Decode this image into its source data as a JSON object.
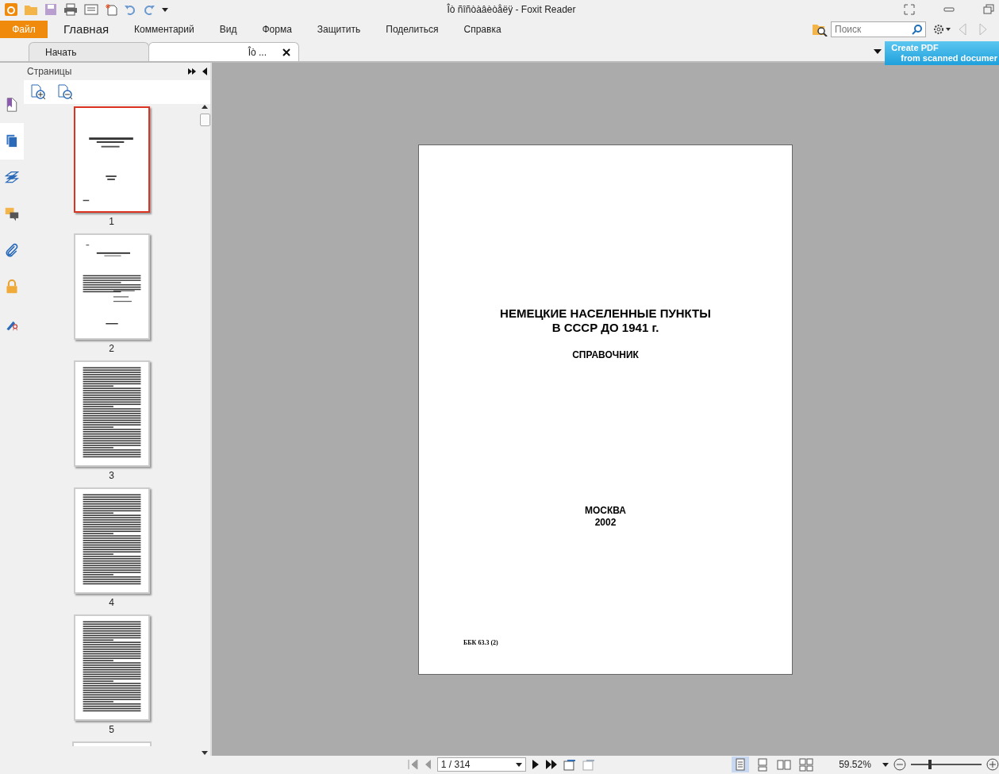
{
  "window": {
    "title": "Îò ñîñòàâèòåëÿ - Foxit Reader"
  },
  "file_button": "Файл",
  "ribbon_tabs": [
    {
      "label": "Главная",
      "selected": true
    },
    {
      "label": "Комментарий",
      "selected": false
    },
    {
      "label": "Вид",
      "selected": false
    },
    {
      "label": "Форма",
      "selected": false
    },
    {
      "label": "Защитить",
      "selected": false
    },
    {
      "label": "Поделиться",
      "selected": false
    },
    {
      "label": "Справка",
      "selected": false
    }
  ],
  "search": {
    "placeholder": "Поиск"
  },
  "doc_tabs": [
    {
      "label": "Начать",
      "selected": false
    },
    {
      "label": "Îò ...",
      "selected": true
    }
  ],
  "banner": {
    "line_1": "Create PDF",
    "line_2": "from scanned documer"
  },
  "side_rail": [
    {
      "kind": "bookmark",
      "selected": false
    },
    {
      "kind": "pages",
      "selected": true
    },
    {
      "kind": "layers",
      "selected": false
    },
    {
      "kind": "comments",
      "selected": false
    },
    {
      "kind": "attachment",
      "selected": false
    },
    {
      "kind": "lock",
      "selected": false
    },
    {
      "kind": "signature",
      "selected": false
    }
  ],
  "sidebar": {
    "title": "Страницы",
    "thumbnails": [
      {
        "label": "1",
        "kind": "cover",
        "selected": true
      },
      {
        "label": "2",
        "kind": "sparse",
        "selected": false
      },
      {
        "label": "3",
        "kind": "dense",
        "selected": false
      },
      {
        "label": "4",
        "kind": "dense",
        "selected": false
      },
      {
        "label": "5",
        "kind": "dense",
        "selected": false
      }
    ]
  },
  "page": {
    "title_lines": [
      "НЕМЕЦКИЕ НАСЕЛЕННЫЕ ПУНКТЫ",
      "В СССР ДО 1941 г."
    ],
    "subtitle": "СПРАВОЧНИК",
    "city": "МОСКВА",
    "year": "2002",
    "code": "ББК 63.3 (2)"
  },
  "status_bar": {
    "page_field": "1 / 314",
    "zoom": "59.52%",
    "zoom_slider": {
      "level": 0.27
    },
    "view_modes": [
      {
        "kind": "single",
        "selected": true
      },
      {
        "kind": "continuous",
        "selected": false
      },
      {
        "kind": "facing",
        "selected": false
      },
      {
        "kind": "facing_continuous",
        "selected": false
      }
    ]
  }
}
